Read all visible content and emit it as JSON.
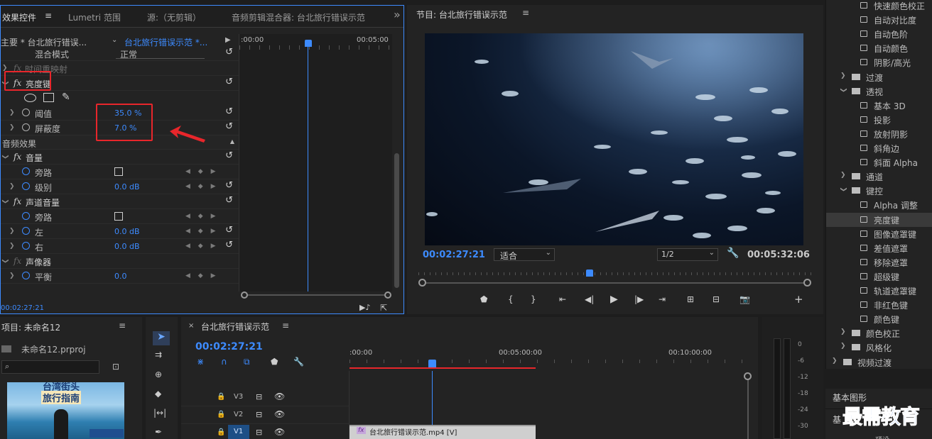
{
  "effect_controls": {
    "tab_active": "效果控件",
    "tab_lumetri": "Lumetri 范围",
    "tab_source": "源:（无剪辑）",
    "tab_mixer": "音频剪辑混合器: 台北旅行错误示范",
    "overflow_icon": "»",
    "master_clip": "主要 * 台北旅行错误...",
    "sequence_clip": "台北旅行错误示范 *...",
    "ruler_start": ":00:00",
    "ruler_end": "00:05:00",
    "blend_mode_label": "混合模式",
    "blend_mode_value": "正常",
    "time_remap_label": "时间重映射",
    "luma_key_label": "亮度键",
    "threshold_label": "阈值",
    "threshold_value": "35.0 %",
    "cutoff_label": "屏蔽度",
    "cutoff_value": "7.0 %",
    "audio_effects_label": "音频效果",
    "volume_label": "音量",
    "bypass_label": "旁路",
    "level_label": "级别",
    "level_value": "0.0 dB",
    "channel_volume_label": "声道音量",
    "bypass2_label": "旁路",
    "left_label": "左",
    "left_value": "0.0 dB",
    "right_label": "右",
    "right_value": "0.0 dB",
    "panner_label": "声像器",
    "balance_label": "平衡",
    "balance_value": "0.0",
    "timecode": "00:02:27:21"
  },
  "program_monitor": {
    "title": "节目: 台北旅行错误示范",
    "timecode": "00:02:27:21",
    "fit_value": "适合",
    "resolution_value": "1/2",
    "duration": "00:05:32:06"
  },
  "effects_panel": {
    "items": [
      {
        "type": "file",
        "label": "快速颜色校正"
      },
      {
        "type": "file",
        "label": "自动对比度"
      },
      {
        "type": "file",
        "label": "自动色阶"
      },
      {
        "type": "file",
        "label": "自动颜色"
      },
      {
        "type": "file",
        "label": "阴影/高光"
      },
      {
        "type": "folder",
        "label": "过渡",
        "open": false
      },
      {
        "type": "folder",
        "label": "透视",
        "open": true
      },
      {
        "type": "file",
        "label": "基本 3D"
      },
      {
        "type": "file",
        "label": "投影"
      },
      {
        "type": "file",
        "label": "放射阴影"
      },
      {
        "type": "file",
        "label": "斜角边"
      },
      {
        "type": "file",
        "label": "斜面 Alpha"
      },
      {
        "type": "folder",
        "label": "通道",
        "open": false
      },
      {
        "type": "folder",
        "label": "键控",
        "open": true
      },
      {
        "type": "file",
        "label": "Alpha 调整"
      },
      {
        "type": "file",
        "label": "亮度键",
        "selected": true
      },
      {
        "type": "file",
        "label": "图像遮罩键"
      },
      {
        "type": "file",
        "label": "差值遮罩"
      },
      {
        "type": "file",
        "label": "移除遮罩"
      },
      {
        "type": "file",
        "label": "超级键"
      },
      {
        "type": "file",
        "label": "轨道遮罩键"
      },
      {
        "type": "file",
        "label": "非红色键"
      },
      {
        "type": "file",
        "label": "颜色键"
      },
      {
        "type": "folder",
        "label": "颜色校正",
        "open": false
      },
      {
        "type": "folder",
        "label": "风格化",
        "open": false
      },
      {
        "type": "folder-top",
        "label": "视频过渡",
        "open": false
      }
    ],
    "basic_graphics": "基本图形",
    "basic_sound": "基",
    "presets": "预设"
  },
  "project": {
    "title": "项目: 未命名12",
    "file": "未命名12.prproj",
    "thumb_line1": "台湾街头",
    "thumb_line2": "旅行指南"
  },
  "timeline": {
    "title": "台北旅行错误示范",
    "timecode": "00:02:27:21",
    "ruler": [
      ":00:00",
      "00:05:00:00",
      "00:10:00:00"
    ],
    "tracks": [
      "V3",
      "V2",
      "V1"
    ],
    "clip_label": "台北旅行错误示范.mp4 [V]"
  },
  "audio_meter": {
    "ticks": [
      "0",
      "-6",
      "-12",
      "-18",
      "-24",
      "-30"
    ]
  },
  "watermark": "最需教育",
  "colors": {
    "accent_blue": "#3d8bff",
    "highlight_red": "#e8262b",
    "panel_bg": "#232323"
  }
}
